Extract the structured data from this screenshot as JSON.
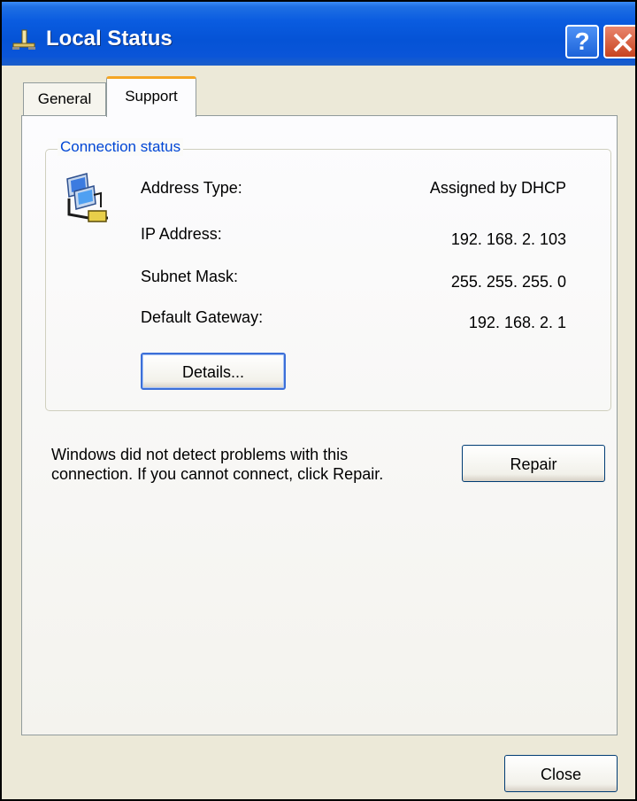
{
  "window": {
    "title": "Local Status",
    "help_label": "?"
  },
  "tabs": [
    {
      "label": "General",
      "selected": false
    },
    {
      "label": "Support",
      "selected": true
    }
  ],
  "connection_status": {
    "legend": "Connection status",
    "rows": [
      {
        "label": "Address Type:",
        "value": "Assigned by DHCP"
      },
      {
        "label": "IP Address:",
        "value": "192. 168. 2. 103"
      },
      {
        "label": "Subnet Mask:",
        "value": "255. 255. 255. 0"
      },
      {
        "label": "Default Gateway:",
        "value": "192. 168. 2. 1"
      }
    ],
    "details_label": "Details..."
  },
  "support": {
    "message": "Windows did not detect problems with this connection. If you cannot connect, click Repair.",
    "repair_label": "Repair"
  },
  "footer": {
    "close_label": "Close"
  },
  "icons": {
    "title": "network-plug-icon",
    "connection": "network-computers-icon",
    "close": "close-x-icon"
  },
  "colors": {
    "titlebar": "#0553d6",
    "legend_text": "#0046d5",
    "selected_tab_accent": "#f5a623",
    "close_button": "#c8431f"
  }
}
